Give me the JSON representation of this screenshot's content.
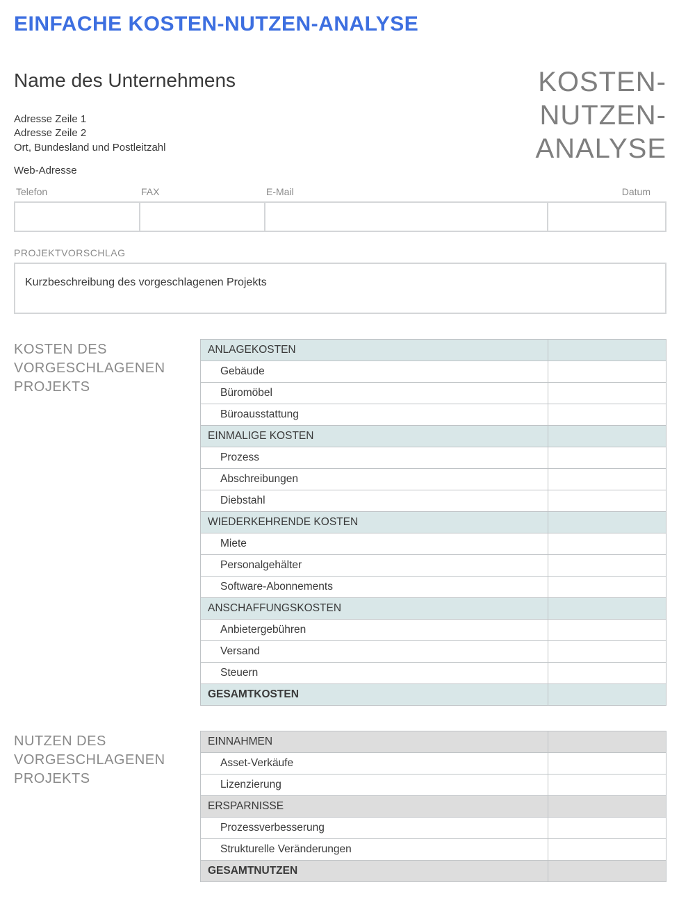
{
  "title": "EINFACHE KOSTEN-NUTZEN-ANALYSE",
  "doc_title_lines": [
    "KOSTEN-",
    "NUTZEN-",
    "ANALYSE"
  ],
  "company": {
    "name": "Name des Unternehmens",
    "address1": "Adresse Zeile 1",
    "address2": "Adresse Zeile 2",
    "city_state_zip": "Ort, Bundesland und Postleitzahl",
    "web": "Web-Adresse"
  },
  "contact": {
    "headers": {
      "phone": "Telefon",
      "fax": "FAX",
      "email": "E-Mail",
      "date": "Datum"
    },
    "values": {
      "phone": "",
      "fax": "",
      "email": "",
      "date": ""
    }
  },
  "project": {
    "section_label": "PROJEKTVORSCHLAG",
    "description": "Kurzbeschreibung des vorgeschlagenen Projekts"
  },
  "costs": {
    "side_label": "KOSTEN DES VORGESCHLAGENEN PROJEKTS",
    "groups": [
      {
        "category": "ANLAGEKOSTEN",
        "items": [
          {
            "label": "Gebäude",
            "value": ""
          },
          {
            "label": "Büromöbel",
            "value": ""
          },
          {
            "label": "Büroausstattung",
            "value": ""
          }
        ]
      },
      {
        "category": "EINMALIGE KOSTEN",
        "items": [
          {
            "label": "Prozess",
            "value": ""
          },
          {
            "label": "Abschreibungen",
            "value": ""
          },
          {
            "label": "Diebstahl",
            "value": ""
          }
        ]
      },
      {
        "category": "WIEDERKEHRENDE KOSTEN",
        "items": [
          {
            "label": "Miete",
            "value": ""
          },
          {
            "label": "Personalgehälter",
            "value": ""
          },
          {
            "label": "Software-Abonnements",
            "value": ""
          }
        ]
      },
      {
        "category": "ANSCHAFFUNGSKOSTEN",
        "items": [
          {
            "label": "Anbietergebühren",
            "value": ""
          },
          {
            "label": "Versand",
            "value": ""
          },
          {
            "label": "Steuern",
            "value": ""
          }
        ]
      }
    ],
    "total_label": "GESAMTKOSTEN",
    "total_value": ""
  },
  "benefits": {
    "side_label": "NUTZEN DES VORGESCHLAGENEN PROJEKTS",
    "groups": [
      {
        "category": "EINNAHMEN",
        "items": [
          {
            "label": "Asset-Verkäufe",
            "value": ""
          },
          {
            "label": "Lizenzierung",
            "value": ""
          }
        ]
      },
      {
        "category": "ERSPARNISSE",
        "items": [
          {
            "label": "Prozessverbesserung",
            "value": ""
          },
          {
            "label": "Strukturelle Veränderungen",
            "value": ""
          }
        ]
      }
    ],
    "total_label": "GESAMTNUTZEN",
    "total_value": ""
  }
}
